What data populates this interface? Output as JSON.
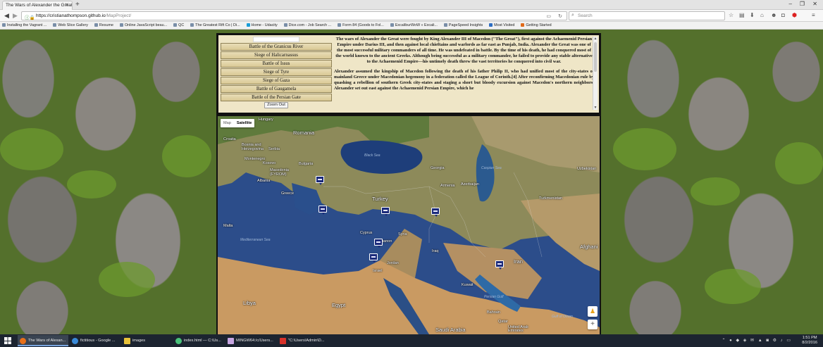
{
  "browser": {
    "tab_title": "The Wars of Alexander the Great",
    "url_host": "https://cristianathompson.github.io",
    "url_path": "/MapProject/",
    "search_placeholder": "Search",
    "bookmarks": [
      "Installing the Vagrant ...",
      "Web Slice Gallery",
      "Resume",
      "Online JavaScript beau...",
      "QC",
      "The Greatest Rift Co | Di...",
      "Home - Udacity",
      "Dice.com - Job Search ...",
      "Form 84 (Goods to Fol...",
      "ExcaliburWoW » Excali...",
      "PageSpeed Insights",
      "Most Visited",
      "Getting Started"
    ]
  },
  "battles": {
    "items": [
      "Battle of the Granicus River",
      "Siege of Halicarnassus",
      "Battle of Issus",
      "Siege of Tyre",
      "Siege of Gaza",
      "Battle of Gaugamela",
      "Battle of the Persian Gate"
    ],
    "zoom_out_label": "Zoom Out"
  },
  "article": {
    "paragraph1": "The wars of Alexander the Great were fought by King Alexander III of Macedon (\"The Great\"), first against the Achaemenid Persian Empire under Darius III, and then against local chieftains and warlords as far east as Punjab, India. Alexander the Great was one of the most successful military commanders of all time. He was undefeated in battle. By the time of his death, he had conquered most of the world known to the ancient Greeks. Although being successful as a military commander, he failed to provide any stable alternative to the Achaemenid Empire—his untimely death threw the vast territories he conquered into civil war.",
    "paragraph2": "Alexander assumed the kingship of Macedon following the death of his father Philip II, who had unified most of the city-states of mainland Greece under Macedonian hegemony in a federation called the League of Corinth.[4] After reconfirming Macedonian rule by quashing a rebellion of southern Greek city-states and staging a short but bloody excursion against Macedon's northern neighbors, Alexander set out east against the Achaemenid Persian Empire, which he"
  },
  "map": {
    "type_map": "Map",
    "type_satellite": "Satellite",
    "labels": {
      "romania": "Romania",
      "hungary": "Hungary",
      "croatia": "Croatia",
      "bosnia": "Bosnia and Herzegovina",
      "serbia": "Serbia",
      "montenegro": "Montenegro",
      "kosovo": "Kosovo",
      "macedonia": "Macedonia (FYROM)",
      "albania": "Albania",
      "bulgaria": "Bulgaria",
      "greece": "Greece",
      "turkey": "Turkey",
      "black_sea": "Black Sea",
      "georgia": "Georgia",
      "caspian_sea": "Caspian Sea",
      "armenia": "Armenia",
      "azerbaijan": "Azerbaijan",
      "uzbekistan": "Uzbekistan",
      "turkmenistan": "Turkmenistan",
      "malta": "Malta",
      "cyprus": "Cyprus",
      "syria": "Syria",
      "lebanon": "Lebanon",
      "mediterranean_sea": "Mediterranean Sea",
      "iraq": "Iraq",
      "iran": "Iran",
      "afghanistan": "Afghani",
      "jordan": "Jordan",
      "israel": "Israel",
      "kuwait": "Kuwait",
      "persian_gulf": "Persian Gulf",
      "bahrain": "Bahrain",
      "qatar": "Qatar",
      "uae": "United Arab Emirates",
      "gulf_of_oman": "Gulf of Oman",
      "libya": "Libya",
      "egypt": "Egypt",
      "saudi_arabia": "Saudi Arabia"
    }
  },
  "taskbar": {
    "items": [
      "The Wars of Alexan...",
      "fictitious - Google ...",
      "images",
      "index.html — C:\\Us...",
      "MINGW64:/c/Users...",
      "\"C:\\Users\\Admin\\D..."
    ],
    "time": "1:51 PM",
    "date": "8/2/2016"
  },
  "colors": {
    "accent": "#1b2a7a",
    "panel_bg": "#efe6c7",
    "panel_border": "#111111"
  }
}
